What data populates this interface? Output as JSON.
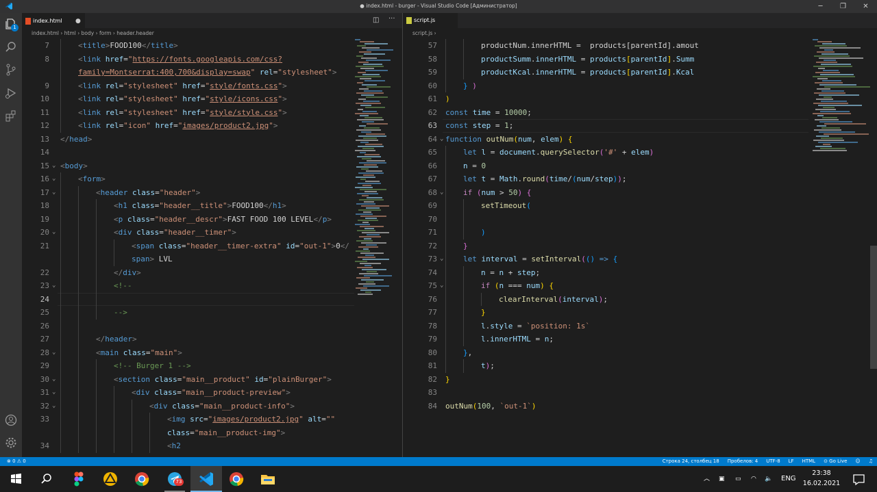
{
  "window": {
    "title": "● index.html - burger - Visual Studio Code [Администратор]",
    "min": "─",
    "max": "❐",
    "close": "✕"
  },
  "activity": {
    "icons": [
      "files-icon",
      "search-icon",
      "source-control-icon",
      "run-debug-icon",
      "extensions-icon",
      "account-icon",
      "settings-gear-icon"
    ],
    "badge": "1"
  },
  "left": {
    "tab": "index.html",
    "breadcrumb": [
      "index.html",
      "html",
      "body",
      "form",
      "header.header"
    ],
    "lines": [
      {
        "n": "7",
        "h": "<span class=\"p\">&lt;</span><span class=\"t\">title</span><span class=\"p\">&gt;</span>FOOD100<span class=\"p\">&lt;/</span><span class=\"t\">title</span><span class=\"p\">&gt;</span>",
        "i": 1
      },
      {
        "n": "8",
        "h": "<span class=\"p\">&lt;</span><span class=\"t\">link</span> <span class=\"a\">href</span>=<span class=\"s\">\"<u>https://fonts.googleapis.com/css?</u></span>",
        "i": 1
      },
      {
        "n": "",
        "h": "<span class=\"s\"><u>family=Montserrat:400,700&amp;display=swap</u>\"</span> <span class=\"a\">rel</span>=<span class=\"s\">\"stylesheet\"</span><span class=\"p\">&gt;</span>",
        "i": 1
      },
      {
        "n": "9",
        "h": "<span class=\"p\">&lt;</span><span class=\"t\">link</span> <span class=\"a\">rel</span>=<span class=\"s\">\"stylesheet\"</span> <span class=\"a\">href</span>=<span class=\"s\">\"<u>style/fonts.css</u>\"</span><span class=\"p\">&gt;</span>",
        "i": 1
      },
      {
        "n": "10",
        "h": "<span class=\"p\">&lt;</span><span class=\"t\">link</span> <span class=\"a\">rel</span>=<span class=\"s\">\"stylesheet\"</span> <span class=\"a\">href</span>=<span class=\"s\">\"<u>style/icons.css</u>\"</span><span class=\"p\">&gt;</span>",
        "i": 1
      },
      {
        "n": "11",
        "h": "<span class=\"p\">&lt;</span><span class=\"t\">link</span> <span class=\"a\">rel</span>=<span class=\"s\">\"stylesheet\"</span> <span class=\"a\">href</span>=<span class=\"s\">\"<u>style/style.css</u>\"</span><span class=\"p\">&gt;</span>",
        "i": 1
      },
      {
        "n": "12",
        "h": "<span class=\"p\">&lt;</span><span class=\"t\">link</span> <span class=\"a\">rel</span>=<span class=\"s\">\"icon\"</span> <span class=\"a\">href</span>=<span class=\"s\">\"<u>images/product2.jpg</u>\"</span><span class=\"p\">&gt;</span>",
        "i": 1
      },
      {
        "n": "13",
        "h": "<span class=\"p\">&lt;/</span><span class=\"t\">head</span><span class=\"p\">&gt;</span>",
        "i": 0
      },
      {
        "n": "14",
        "h": "",
        "i": 0
      },
      {
        "n": "15",
        "h": "<span class=\"p\">&lt;</span><span class=\"t\">body</span><span class=\"p\">&gt;</span>",
        "i": 0,
        "fold": 1
      },
      {
        "n": "16",
        "h": "<span class=\"p\">&lt;</span><span class=\"t\">form</span><span class=\"p\">&gt;</span>",
        "i": 1,
        "fold": 1
      },
      {
        "n": "17",
        "h": "<span class=\"p\">&lt;</span><span class=\"t\">header</span> <span class=\"a\">class</span>=<span class=\"s\">\"header\"</span><span class=\"p\">&gt;</span>",
        "i": 2,
        "fold": 1
      },
      {
        "n": "18",
        "h": "<span class=\"p\">&lt;</span><span class=\"t\">h1</span> <span class=\"a\">class</span>=<span class=\"s\">\"header__title\"</span><span class=\"p\">&gt;</span>FOOD100<span class=\"p\">&lt;/</span><span class=\"t\">h1</span><span class=\"p\">&gt;</span>",
        "i": 3
      },
      {
        "n": "19",
        "h": "<span class=\"p\">&lt;</span><span class=\"t\">p</span> <span class=\"a\">class</span>=<span class=\"s\">\"header__descr\"</span><span class=\"p\">&gt;</span>FAST FOOD 100 LEVEL<span class=\"p\">&lt;/</span><span class=\"t\">p</span><span class=\"p\">&gt;</span>",
        "i": 3
      },
      {
        "n": "20",
        "h": "<span class=\"p\">&lt;</span><span class=\"t\">div</span> <span class=\"a\">class</span>=<span class=\"s\">\"header__timer\"</span><span class=\"p\">&gt;</span>",
        "i": 3,
        "fold": 1
      },
      {
        "n": "21",
        "h": "<span class=\"p\">&lt;</span><span class=\"t\">span</span> <span class=\"a\">class</span>=<span class=\"s\">\"header__timer-extra\"</span> <span class=\"a\">id</span>=<span class=\"s\">\"out-1\"</span><span class=\"p\">&gt;</span>0<span class=\"p\">&lt;/</span>",
        "i": 4
      },
      {
        "n": "",
        "h": "<span class=\"t\">span</span><span class=\"p\">&gt;</span> LVL",
        "i": 4
      },
      {
        "n": "22",
        "h": "<span class=\"p\">&lt;/</span><span class=\"t\">div</span><span class=\"p\">&gt;</span>",
        "i": 3
      },
      {
        "n": "23",
        "h": "<span class=\"c\">&lt;!--</span>",
        "i": 3,
        "fold": 1
      },
      {
        "n": "24",
        "h": "",
        "i": 3,
        "cur": 1
      },
      {
        "n": "25",
        "h": "<span class=\"c\">--&gt;</span>",
        "i": 3
      },
      {
        "n": "26",
        "h": "",
        "i": 2
      },
      {
        "n": "27",
        "h": "<span class=\"p\">&lt;/</span><span class=\"t\">header</span><span class=\"p\">&gt;</span>",
        "i": 2
      },
      {
        "n": "28",
        "h": "<span class=\"p\">&lt;</span><span class=\"t\">main</span> <span class=\"a\">class</span>=<span class=\"s\">\"main\"</span><span class=\"p\">&gt;</span>",
        "i": 2,
        "fold": 1
      },
      {
        "n": "29",
        "h": "<span class=\"c\">&lt;!-- Burger 1 --&gt;</span>",
        "i": 3
      },
      {
        "n": "30",
        "h": "<span class=\"p\">&lt;</span><span class=\"t\">section</span> <span class=\"a\">class</span>=<span class=\"s\">\"main__product\"</span> <span class=\"a\">id</span>=<span class=\"s\">\"plainBurger\"</span><span class=\"p\">&gt;</span>",
        "i": 3,
        "fold": 1
      },
      {
        "n": "31",
        "h": "<span class=\"p\">&lt;</span><span class=\"t\">div</span> <span class=\"a\">class</span>=<span class=\"s\">\"main__product-preview\"</span><span class=\"p\">&gt;</span>",
        "i": 4,
        "fold": 1
      },
      {
        "n": "32",
        "h": "<span class=\"p\">&lt;</span><span class=\"t\">div</span> <span class=\"a\">class</span>=<span class=\"s\">\"main__product-info\"</span><span class=\"p\">&gt;</span>",
        "i": 5,
        "fold": 1
      },
      {
        "n": "33",
        "h": "<span class=\"p\">&lt;</span><span class=\"t\">img</span> <span class=\"a\">src</span>=<span class=\"s\">\"<u>images/product2.jpg</u>\"</span> <span class=\"a\">alt</span>=<span class=\"s\">\"\"</span>",
        "i": 6
      },
      {
        "n": "",
        "h": "<span class=\"a\">class</span>=<span class=\"s\">\"main__product-img\"</span><span class=\"p\">&gt;</span>",
        "i": 6
      },
      {
        "n": "34",
        "h": "<span class=\"p\">&lt;</span><span class=\"t\">h2</span>",
        "i": 6
      }
    ]
  },
  "right": {
    "tab": "script.js",
    "breadcrumb": [
      "script.js"
    ],
    "lines": [
      {
        "n": "57",
        "h": "productNum.innerHTML =  products[parentId].amout",
        "i": 2
      },
      {
        "n": "58",
        "h": "<span class=\"v\">productSumm</span>.<span class=\"v\">innerHTML</span> = <span class=\"v\">products</span><span class=\"b1\">[</span><span class=\"v\">parentId</span><span class=\"b1\">]</span>.<span class=\"v\">Summ</span>",
        "i": 2
      },
      {
        "n": "59",
        "h": "<span class=\"v\">productKcal</span>.<span class=\"v\">innerHTML</span> = <span class=\"v\">products</span><span class=\"b1\">[</span><span class=\"v\">parentId</span><span class=\"b1\">]</span>.<span class=\"v\">Kcal</span>",
        "i": 2
      },
      {
        "n": "60",
        "h": "<span class=\"b3\">}</span> <span class=\"b2\">)</span>",
        "i": 1
      },
      {
        "n": "61",
        "h": "<span class=\"b1\">)</span>",
        "i": 0
      },
      {
        "n": "62",
        "h": "<span class=\"k\">const</span> <span class=\"v\">time</span> = <span class=\"n\">10000</span>;",
        "i": 0
      },
      {
        "n": "63",
        "h": "<span class=\"k\">const</span> <span class=\"v\">step</span> = <span class=\"n\">1</span>;",
        "i": 0,
        "cur": 1
      },
      {
        "n": "64",
        "h": "<span class=\"k\">function</span> <span class=\"f\">outNum</span><span class=\"b1\">(</span><span class=\"v\">num</span>, <span class=\"v\">elem</span><span class=\"b1\">)</span> <span class=\"b1\">{</span>",
        "i": 0,
        "fold": 1
      },
      {
        "n": "65",
        "h": "<span class=\"k\">let</span> <span class=\"v\">l</span> = <span class=\"v\">document</span>.<span class=\"f\">querySelector</span><span class=\"b2\">(</span><span class=\"s\">'#'</span> + <span class=\"v\">elem</span><span class=\"b2\">)</span>",
        "i": 1
      },
      {
        "n": "66",
        "h": "<span class=\"v\">n</span> = <span class=\"n\">0</span>",
        "i": 1
      },
      {
        "n": "67",
        "h": "<span class=\"k\">let</span> <span class=\"v\">t</span> = <span class=\"v\">Math</span>.<span class=\"f\">round</span><span class=\"b2\">(</span><span class=\"v\">time</span>/<span class=\"b3\">(</span><span class=\"v\">num</span>/<span class=\"v\">step</span><span class=\"b3\">)</span><span class=\"b2\">)</span>;",
        "i": 1
      },
      {
        "n": "68",
        "h": "<span class=\"ctrl\">if</span> <span class=\"b2\">(</span><span class=\"v\">num</span> &gt; <span class=\"n\">50</span><span class=\"b2\">)</span> <span class=\"b2\">{</span>",
        "i": 1,
        "fold": 1
      },
      {
        "n": "69",
        "h": "<span class=\"f\">setTimeout</span><span class=\"b3\">(</span>",
        "i": 2
      },
      {
        "n": "70",
        "h": "",
        "i": 2
      },
      {
        "n": "71",
        "h": "<span class=\"b3\">)</span>",
        "i": 2
      },
      {
        "n": "72",
        "h": "<span class=\"b2\">}</span>",
        "i": 1
      },
      {
        "n": "73",
        "h": "<span class=\"k\">let</span> <span class=\"v\">interval</span> = <span class=\"f\">setInterval</span><span class=\"b2\">(</span><span class=\"b3\">()</span> <span class=\"k\">=&gt;</span> <span class=\"b3\">{</span>",
        "i": 1,
        "fold": 1
      },
      {
        "n": "74",
        "h": "<span class=\"v\">n</span> = <span class=\"v\">n</span> + <span class=\"v\">step</span>;",
        "i": 2
      },
      {
        "n": "75",
        "h": "<span class=\"ctrl\">if</span> <span class=\"b1\">(</span><span class=\"v\">n</span> === <span class=\"v\">num</span><span class=\"b1\">)</span> <span class=\"b1\">{</span>",
        "i": 2,
        "fold": 1
      },
      {
        "n": "76",
        "h": "<span class=\"f\">clearInterval</span><span class=\"b2\">(</span><span class=\"v\">interval</span><span class=\"b2\">)</span>;",
        "i": 3
      },
      {
        "n": "77",
        "h": "<span class=\"b1\">}</span>",
        "i": 2
      },
      {
        "n": "78",
        "h": "<span class=\"v\">l</span>.<span class=\"v\">style</span> = <span class=\"s\">`position: 1s`</span>",
        "i": 2
      },
      {
        "n": "79",
        "h": "<span class=\"v\">l</span>.<span class=\"v\">innerHTML</span> = <span class=\"v\">n</span>;",
        "i": 2
      },
      {
        "n": "80",
        "h": "<span class=\"b3\">}</span>,",
        "i": 1
      },
      {
        "n": "81",
        "h": "<span class=\"v\">t</span><span class=\"b2\">)</span>;",
        "i": 2
      },
      {
        "n": "82",
        "h": "<span class=\"b1\">}</span>",
        "i": 0
      },
      {
        "n": "83",
        "h": "",
        "i": 0
      },
      {
        "n": "84",
        "h": "<span class=\"f\">outNum</span><span class=\"b1\">(</span><span class=\"n\">100</span>, <span class=\"s\">`out-1`</span><span class=\"b1\">)</span>",
        "i": 0
      }
    ]
  },
  "status": {
    "left": "⊗ 0 ⚠ 0",
    "position": "Строка 24, столбец 18",
    "spaces": "Пробелов: 4",
    "encoding": "UTF-8",
    "eol": "LF",
    "language": "HTML",
    "golive": "⊙ Go Live",
    "bell": "🔔"
  },
  "taskbar": {
    "apps": [
      "windows-start-icon",
      "search-icon",
      "figma-icon",
      "arduino-icon",
      "chrome-icon",
      "telegram-icon",
      "vscode-icon",
      "chrome-icon",
      "file-explorer-icon"
    ],
    "telegram_badge": "73",
    "lang": "ENG",
    "time": "23:38",
    "date": "16.02.2021"
  }
}
